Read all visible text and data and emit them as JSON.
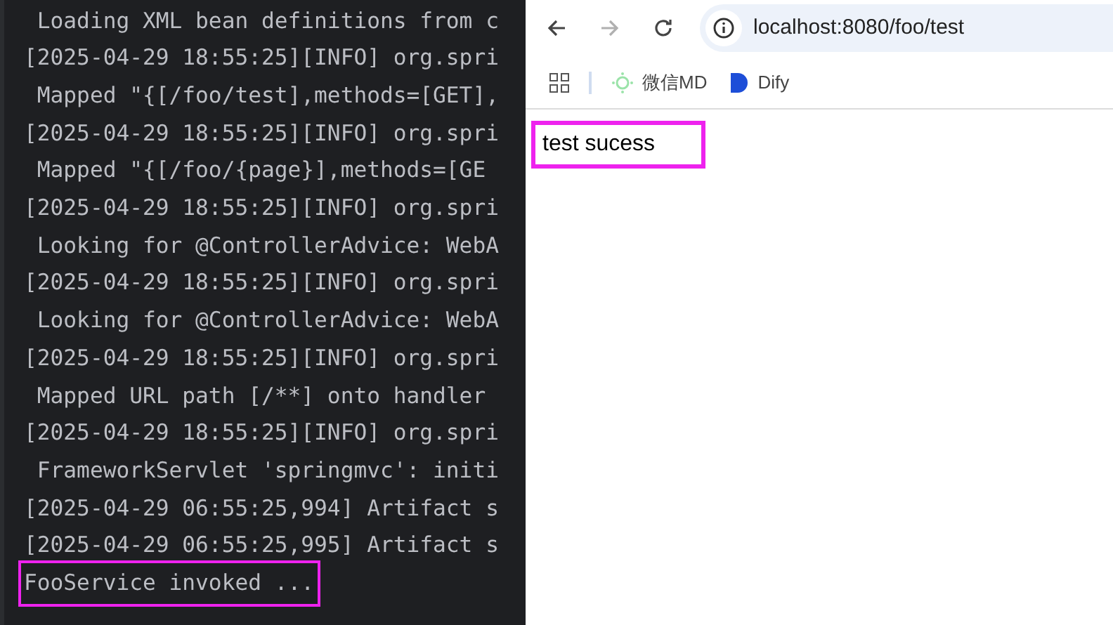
{
  "console": {
    "lines": [
      {
        "text": " Loading XML bean definitions from c",
        "highlighted": false
      },
      {
        "text": "[2025-04-29 18:55:25][INFO] org.spri",
        "highlighted": false
      },
      {
        "text": " Mapped \"{[/foo/test],methods=[GET],",
        "highlighted": false
      },
      {
        "text": "[2025-04-29 18:55:25][INFO] org.spri",
        "highlighted": false
      },
      {
        "text": " Mapped \"{[/foo/{page}],methods=[GE",
        "highlighted": false
      },
      {
        "text": "[2025-04-29 18:55:25][INFO] org.spri",
        "highlighted": false
      },
      {
        "text": " Looking for @ControllerAdvice: WebA",
        "highlighted": false
      },
      {
        "text": "[2025-04-29 18:55:25][INFO] org.spri",
        "highlighted": false
      },
      {
        "text": " Looking for @ControllerAdvice: WebA",
        "highlighted": false
      },
      {
        "text": "[2025-04-29 18:55:25][INFO] org.spri",
        "highlighted": false
      },
      {
        "text": " Mapped URL path [/**] onto handler",
        "highlighted": false
      },
      {
        "text": "[2025-04-29 18:55:25][INFO] org.spri",
        "highlighted": false
      },
      {
        "text": " FrameworkServlet 'springmvc': initi",
        "highlighted": false
      },
      {
        "text": "[2025-04-29 06:55:25,994] Artifact s",
        "highlighted": false
      },
      {
        "text": "[2025-04-29 06:55:25,995] Artifact s",
        "highlighted": false
      },
      {
        "text": "FooService invoked ...",
        "highlighted": true
      }
    ]
  },
  "browser": {
    "back_disabled": false,
    "forward_disabled": true,
    "url": "localhost:8080/foo/test",
    "bookmarks": [
      {
        "label": "微信MD",
        "kind": "wechat"
      },
      {
        "label": "Dify",
        "kind": "dify"
      }
    ],
    "content": {
      "text": "test sucess",
      "highlighted": true
    }
  }
}
